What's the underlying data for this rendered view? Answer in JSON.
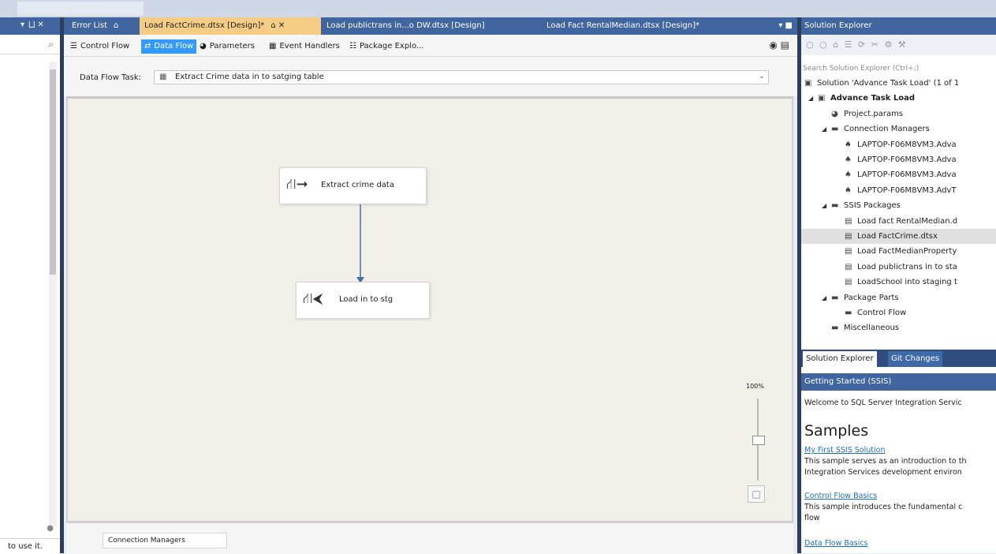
{
  "toolbox": {
    "header_buttons": "▾  ⨆ ✕",
    "bottom_text": "to use it."
  },
  "doc_tabs": [
    {
      "label": "Error List",
      "suffix": "⌂",
      "active": false
    },
    {
      "label": "Load FactCrime.dtsx [Design]*",
      "suffix": "⌂ ✕",
      "active": true
    },
    {
      "label": "Load publictrans in...o DW.dtsx [Design]",
      "suffix": "",
      "active": false
    },
    {
      "label": "Load Fact RentalMedian.dtsx [Design]*",
      "suffix": "",
      "active": false
    }
  ],
  "designer_tabs": [
    {
      "label": "Control Flow",
      "icon": "control-flow-icon",
      "glyph": "☰",
      "active": false
    },
    {
      "label": "Data Flow",
      "icon": "data-flow-icon",
      "glyph": "⇄",
      "active": true
    },
    {
      "label": "Parameters",
      "icon": "parameters-icon",
      "glyph": "◕",
      "active": false
    },
    {
      "label": "Event Handlers",
      "icon": "event-handlers-icon",
      "glyph": "▦",
      "active": false
    },
    {
      "label": "Package Explo...",
      "icon": "package-explorer-icon",
      "glyph": "☷",
      "active": false
    }
  ],
  "data_flow_task": {
    "label": "Data Flow Task:",
    "value": "Extract Crime data in to satging table"
  },
  "components": [
    {
      "label": "Extract crime data",
      "icon": "source-component-icon",
      "glyph": "⮞"
    },
    {
      "label": "Load in to stg",
      "icon": "destination-component-icon",
      "glyph": "⮜"
    }
  ],
  "zoom": {
    "label": "100%",
    "level": 1.0
  },
  "connection_managers": {
    "tab_label": "Connection Managers"
  },
  "solution_explorer": {
    "title": "Solution Explorer",
    "search_placeholder": "Search Solution Explorer (Ctrl+;)",
    "toolbar_glyphs": "○ ○ ⌂ ☰ ⟳ ✂ ⚙ ⚒",
    "tree": [
      {
        "label": "Solution 'Advance Task Load' (1 of 1",
        "icon": "solution-icon",
        "glyph": "▣",
        "expander": "",
        "level": 0,
        "selected": false,
        "bold": false
      },
      {
        "label": "Advance Task Load",
        "icon": "project-icon",
        "glyph": "▣",
        "expander": "◢",
        "level": 1,
        "selected": false,
        "bold": true
      },
      {
        "label": "Project.params",
        "icon": "params-icon",
        "glyph": "◕",
        "expander": "",
        "level": 2,
        "selected": false,
        "bold": false
      },
      {
        "label": "Connection Managers",
        "icon": "folder-icon",
        "glyph": "▬",
        "expander": "◢",
        "level": 2,
        "selected": false,
        "bold": false
      },
      {
        "label": "LAPTOP-F06M8VM3.Adva",
        "icon": "connection-icon",
        "glyph": "♠",
        "expander": "",
        "level": 3,
        "selected": false,
        "bold": false
      },
      {
        "label": "LAPTOP-F06M8VM3.Adva",
        "icon": "connection-icon",
        "glyph": "♠",
        "expander": "",
        "level": 3,
        "selected": false,
        "bold": false
      },
      {
        "label": "LAPTOP-F06M8VM3.Adva",
        "icon": "connection-icon",
        "glyph": "♠",
        "expander": "",
        "level": 3,
        "selected": false,
        "bold": false
      },
      {
        "label": "LAPTOP-F06M8VM3.AdvT",
        "icon": "connection-icon",
        "glyph": "♠",
        "expander": "",
        "level": 3,
        "selected": false,
        "bold": false
      },
      {
        "label": "SSIS Packages",
        "icon": "folder-icon",
        "glyph": "▬",
        "expander": "◢",
        "level": 2,
        "selected": false,
        "bold": false
      },
      {
        "label": "Load fact RentalMedian.d",
        "icon": "package-icon",
        "glyph": "▤",
        "expander": "",
        "level": 3,
        "selected": false,
        "bold": false
      },
      {
        "label": "Load FactCrime.dtsx",
        "icon": "package-icon",
        "glyph": "▤",
        "expander": "",
        "level": 3,
        "selected": true,
        "bold": false
      },
      {
        "label": "Load FactMedianProperty",
        "icon": "package-icon",
        "glyph": "▤",
        "expander": "",
        "level": 3,
        "selected": false,
        "bold": false
      },
      {
        "label": "Load publictrans in to sta",
        "icon": "package-icon",
        "glyph": "▤",
        "expander": "",
        "level": 3,
        "selected": false,
        "bold": false
      },
      {
        "label": "LoadSchool into staging t",
        "icon": "package-icon",
        "glyph": "▤",
        "expander": "",
        "level": 3,
        "selected": false,
        "bold": false
      },
      {
        "label": "Package Parts",
        "icon": "folder-icon",
        "glyph": "▬",
        "expander": "◢",
        "level": 2,
        "selected": false,
        "bold": false
      },
      {
        "label": "Control Flow",
        "icon": "control-flow-part-icon",
        "glyph": "▬",
        "expander": "",
        "level": 3,
        "selected": false,
        "bold": false
      },
      {
        "label": "Miscellaneous",
        "icon": "folder-icon",
        "glyph": "▬",
        "expander": "",
        "level": 2,
        "selected": false,
        "bold": false
      }
    ],
    "bottom_tabs": [
      {
        "label": "Solution Explorer",
        "active": true
      },
      {
        "label": "Git Changes",
        "active": false
      }
    ]
  },
  "getting_started": {
    "title": "Getting Started (SSIS)",
    "welcome": "Welcome to SQL Server Integration Servic",
    "heading": "Samples",
    "items": [
      {
        "link": "My First SSIS Solution",
        "desc1": "This sample serves as an introduction to th",
        "desc2": "Integration Services development environ"
      },
      {
        "link": "Control Flow Basics",
        "desc1": "This sample introduces the fundamental c",
        "desc2": "flow"
      },
      {
        "link": "Data Flow Basics",
        "desc1": "",
        "desc2": ""
      }
    ]
  },
  "colors": {
    "tab_bar": "#41659f",
    "active_doc_tab": "#f5cc84",
    "active_designer_tab": "#3399ff",
    "canvas": "#f0efe8",
    "connector": "#4b6ea9"
  }
}
